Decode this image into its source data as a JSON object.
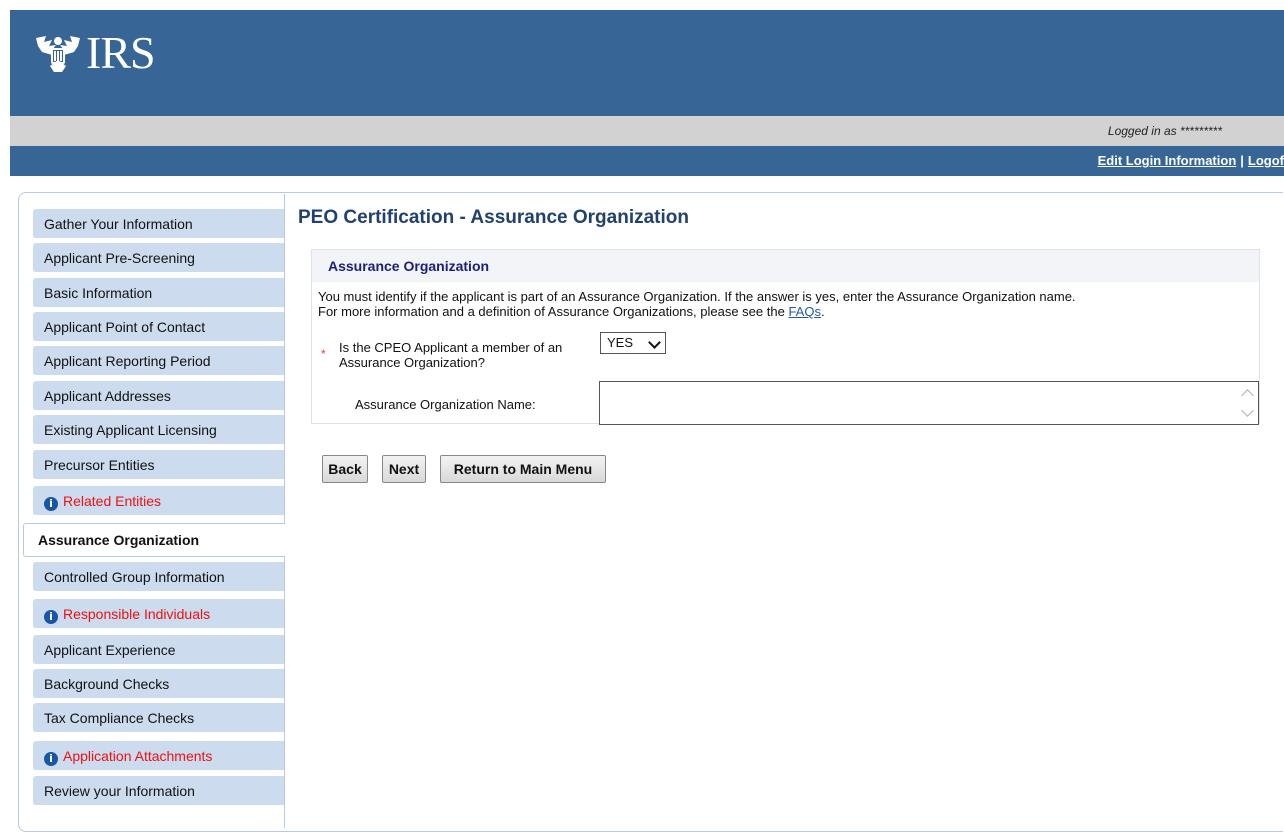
{
  "header": {
    "logo_text": "IRS",
    "logged_in_text": "Logged in as *********",
    "edit_login_label": "Edit Login Information",
    "separator": "|",
    "logout_label": "Logof"
  },
  "sidebar": {
    "items": [
      {
        "label": "Gather Your Information",
        "state": "normal"
      },
      {
        "label": "Applicant Pre-Screening",
        "state": "normal"
      },
      {
        "label": "Basic Information",
        "state": "normal"
      },
      {
        "label": "Applicant Point of Contact",
        "state": "normal"
      },
      {
        "label": "Applicant Reporting Period",
        "state": "normal"
      },
      {
        "label": "Applicant Addresses",
        "state": "normal"
      },
      {
        "label": "Existing Applicant Licensing",
        "state": "normal"
      },
      {
        "label": "Precursor Entities",
        "state": "normal"
      },
      {
        "label": "Related Entities",
        "state": "warning"
      },
      {
        "label": "Assurance Organization",
        "state": "active"
      },
      {
        "label": "Controlled Group Information",
        "state": "normal"
      },
      {
        "label": "Responsible Individuals",
        "state": "warning"
      },
      {
        "label": "Applicant Experience",
        "state": "normal"
      },
      {
        "label": "Background Checks",
        "state": "normal"
      },
      {
        "label": "Tax Compliance Checks",
        "state": "normal"
      },
      {
        "label": "Application Attachments",
        "state": "warning"
      },
      {
        "label": "Review your Information",
        "state": "normal"
      }
    ],
    "warning_color": "#ee1111",
    "info_icon_glyph": "i"
  },
  "main": {
    "page_title": "PEO Certification - Assurance Organization",
    "section_title": "Assurance Organization",
    "description_line1": "You must identify if the applicant is part of an Assurance Organization. If the answer is yes, enter the Assurance Organization name.",
    "description_line2_prefix": "For more information and a definition of Assurance Organizations, please see the ",
    "faq_link": "FAQs",
    "description_line2_suffix": ".",
    "required_marker": "*",
    "question_label": "Is the CPEO Applicant a member of an Assurance Organization?",
    "member_select_value": "YES",
    "name_field_label": "Assurance Organization Name:",
    "name_field_value": ""
  },
  "buttons": {
    "back": "Back",
    "next": "Next",
    "return_main": "Return to Main Menu"
  },
  "colors": {
    "header_blue": "#366596",
    "sidebar_item": "#ccdcee",
    "title_blue": "#21426e",
    "section_title": "#1a1f78"
  }
}
